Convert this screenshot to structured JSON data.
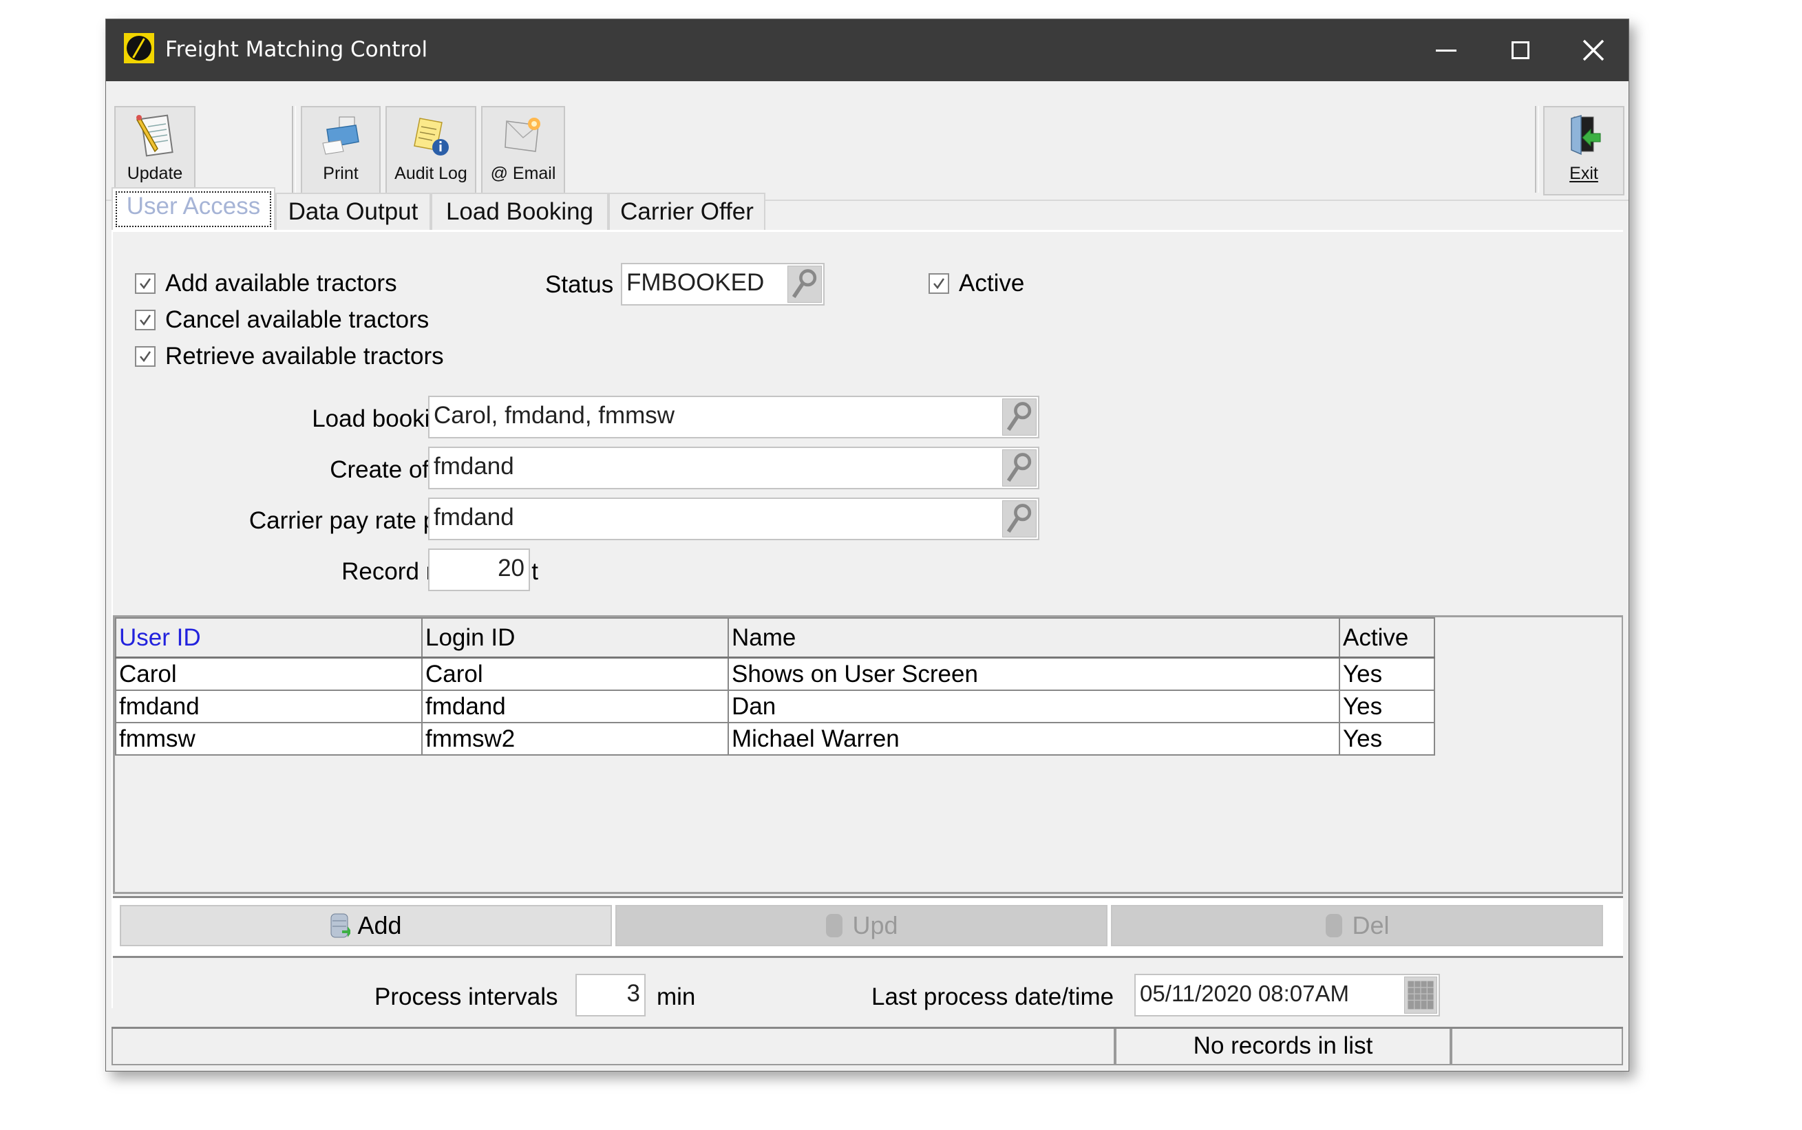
{
  "window": {
    "title": "Freight Matching Control",
    "controls": {
      "minimize": "minimize",
      "maximize": "maximize",
      "close": "close"
    }
  },
  "toolbar": {
    "update_label": "Update",
    "print_label": "Print",
    "audit_log_label": "Audit Log",
    "email_label": "@ Email",
    "exit_label": "Exit"
  },
  "tabs": [
    {
      "label": "User Access",
      "active": true
    },
    {
      "label": "Data Output",
      "active": false
    },
    {
      "label": "Load Booking",
      "active": false
    },
    {
      "label": "Carrier Offer",
      "active": false
    }
  ],
  "user_access": {
    "checkboxes": [
      {
        "label": "Add available tractors",
        "checked": true
      },
      {
        "label": "Cancel available tractors",
        "checked": true
      },
      {
        "label": "Retrieve available tractors",
        "checked": true
      }
    ],
    "status": {
      "label": "Status",
      "value": "FMBOOKED"
    },
    "active": {
      "label": "Active",
      "checked": true
    },
    "load_booking_users": {
      "label": "Load booking user(s)",
      "value": "Carol, fmdand, fmmsw"
    },
    "create_offer_users": {
      "label": "Create offer user(s)",
      "value": "fmdand"
    },
    "carrier_pay_rate_providers": {
      "label": "Carrier pay rate provider(s)",
      "value": "fmdand"
    },
    "record_return_limit": {
      "label": "Record return limit",
      "value": "20"
    }
  },
  "grid": {
    "columns": [
      "User ID",
      "Login ID",
      "Name",
      "Active"
    ],
    "rows": [
      [
        "Carol",
        "Carol",
        "Shows on User Screen",
        "Yes"
      ],
      [
        "fmdand",
        "fmdand",
        "Dan",
        "Yes"
      ],
      [
        "fmmsw",
        "fmmsw2",
        "Michael Warren",
        "Yes"
      ]
    ]
  },
  "grid_buttons": {
    "add_label": "Add",
    "upd_label": "Upd",
    "del_label": "Del"
  },
  "process": {
    "intervals_label": "Process intervals",
    "intervals_value": "3",
    "intervals_unit": "min",
    "last_process_label": "Last process date/time",
    "last_process_value": "05/11/2020 08:07AM"
  },
  "statusbar": {
    "left": "",
    "message": "No records in list",
    "right": ""
  },
  "colors": {
    "titlebar": "#3b3b3b",
    "sort_column_header": "#2222dd",
    "active_tab_text": "#a6b4d6"
  }
}
